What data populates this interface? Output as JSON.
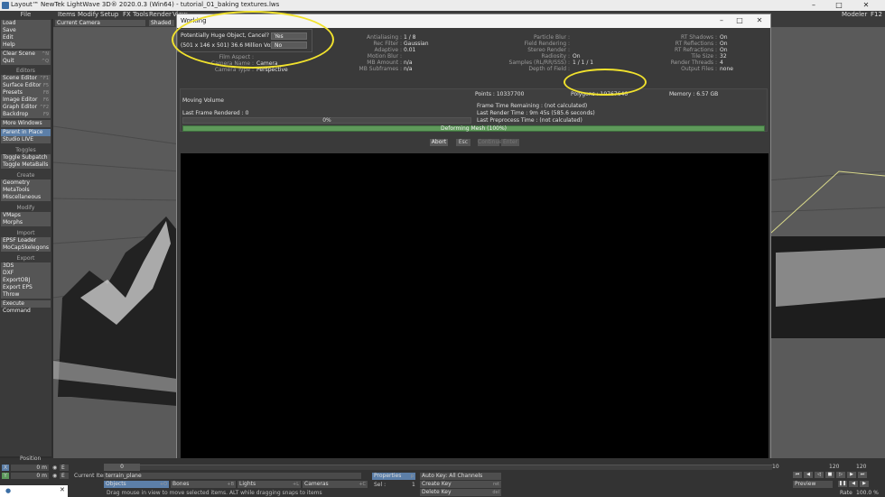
{
  "window": {
    "title": "Layout™ NewTek LightWave 3D® 2020.0.3 (Win64) - tutorial_01_baking textures.lws"
  },
  "menubar": {
    "file": "File",
    "items": [
      "Items",
      "Modify",
      "Setup",
      "FX Tools",
      "Render",
      "View"
    ],
    "modeler": "Modeler",
    "f12": "F12"
  },
  "left_panel": {
    "file_items": [
      {
        "label": "Load",
        "sc": ""
      },
      {
        "label": "Save",
        "sc": ""
      },
      {
        "label": "Edit",
        "sc": ""
      },
      {
        "label": "Help",
        "sc": ""
      },
      {
        "label": "Clear Scene",
        "sc": "^N"
      },
      {
        "label": "Quit",
        "sc": "^Q"
      }
    ],
    "editors_head": "Editors",
    "editors": [
      {
        "label": "Scene Editor",
        "sc": "^F1"
      },
      {
        "label": "Surface Editor",
        "sc": "F5"
      },
      {
        "label": "Presets",
        "sc": "F8"
      },
      {
        "label": "Image Editor",
        "sc": "F6"
      },
      {
        "label": "Graph Editor",
        "sc": "^F2"
      },
      {
        "label": "Backdrop",
        "sc": "F9"
      },
      {
        "label": "More Windows",
        "sc": ""
      }
    ],
    "misc": [
      {
        "label": "Parent in Place",
        "sc": ""
      },
      {
        "label": "Studio LIVE",
        "sc": ""
      }
    ],
    "toggles_head": "Toggles",
    "toggles": [
      {
        "label": "Toggle Subpatch",
        "sc": ""
      },
      {
        "label": "Toggle MetaBalls",
        "sc": ""
      }
    ],
    "create_head": "Create",
    "create": [
      {
        "label": "Geometry",
        "sc": ""
      },
      {
        "label": "MetaTools",
        "sc": ""
      },
      {
        "label": "Miscellaneous",
        "sc": ""
      }
    ],
    "modify_head": "Modify",
    "modify": [
      {
        "label": "VMaps",
        "sc": ""
      },
      {
        "label": "Morphs",
        "sc": ""
      }
    ],
    "import_head": "Import",
    "import": [
      {
        "label": "EPSF Loader",
        "sc": ""
      },
      {
        "label": "MoCapSkelegons",
        "sc": ""
      }
    ],
    "export_head": "Export",
    "export": [
      {
        "label": "3DS",
        "sc": ""
      },
      {
        "label": "DXF",
        "sc": ""
      },
      {
        "label": "ExportOBJ",
        "sc": ""
      },
      {
        "label": "Export EPS",
        "sc": ""
      },
      {
        "label": "Throw",
        "sc": ""
      },
      {
        "label": "Execute Command",
        "sc": ""
      }
    ]
  },
  "viewport": {
    "camera": "Current Camera",
    "shaded": "Shaded"
  },
  "dialog": {
    "title": "Working",
    "left_stats": [
      {
        "label": "Film Aspect :",
        "value": ""
      },
      {
        "label": "Camera Name :",
        "value": "Camera"
      },
      {
        "label": "Camera Type :",
        "value": "Perspective"
      }
    ],
    "mid_stats": [
      {
        "label": "Antialiasing :",
        "value": "1 / 8"
      },
      {
        "label": "Rec Filter :",
        "value": "Gaussian"
      },
      {
        "label": "Adaptive :",
        "value": "0.01"
      },
      {
        "label": "Motion Blur :",
        "value": ""
      },
      {
        "label": "MB Amount :",
        "value": "n/a"
      },
      {
        "label": "MB Subframes :",
        "value": "n/a"
      }
    ],
    "right_stats": [
      {
        "label": "Particle Blur :",
        "value": ""
      },
      {
        "label": "Field Rendering :",
        "value": ""
      },
      {
        "label": "Stereo Render :",
        "value": ""
      },
      {
        "label": "Radiosity :",
        "value": "On"
      },
      {
        "label": "Samples (RL/RR/SSS) :",
        "value": "1 / 1 / 1"
      },
      {
        "label": "Depth of Field :",
        "value": ""
      }
    ],
    "far_stats": [
      {
        "label": "RT Shadows :",
        "value": "On"
      },
      {
        "label": "RT Reflections :",
        "value": "On"
      },
      {
        "label": "RT Refractions :",
        "value": "On"
      },
      {
        "label": "Tile Size :",
        "value": "32"
      },
      {
        "label": "Render Threads :",
        "value": "4"
      },
      {
        "label": "Output Files :",
        "value": "none"
      }
    ],
    "points": "Points : 10337700",
    "polygons": "Polygons : 19767646",
    "memory": "Memory : 6.57 GB",
    "status": "Moving Volume",
    "frame_time_remaining": "Frame Time Remaining : (not calculated)",
    "last_render_time": "Last Render Time : 9m 45s (585.6 seconds)",
    "last_preprocess_time": "Last Preprocess Time : (not calculated)",
    "last_frame_rendered": "Last Frame Rendered : 0",
    "progress1_text": "0%",
    "progress2_text": "Deforming Mesh (100%)",
    "abort": "Abort",
    "esc": "Esc",
    "btn_continue": "Continue",
    "btn_enter": "Enter"
  },
  "warning": {
    "message": "Potentially Huge Object, Cancel?",
    "info": "(501 x 146 x 501) 36.6 Million Voxels",
    "yes": "Yes",
    "no": "No"
  },
  "bottom": {
    "position": "Position",
    "x_axis": "X",
    "y_axis": "Y",
    "x_val": "0 m",
    "y_val": "0 m",
    "e": "E",
    "frame": "0",
    "current_item_label": "Current Item",
    "current_item": "terrain_plane",
    "objects": "Objects",
    "bones": "Bones",
    "lights": "Lights",
    "cameras": "Cameras",
    "sc_o": "+O",
    "sc_b": "+B",
    "sc_l": "+L",
    "sc_c": "+C",
    "properties": "Properties",
    "sc_p": "p",
    "sel": "Sel :",
    "sel_val": "1",
    "auto_key": "Auto Key: All Channels",
    "create_key": "Create Key",
    "delete_key": "Delete Key",
    "sc_ret": "ret",
    "sc_del": "del",
    "status": "Drag mouse in view to move selected items. ALT while dragging snaps to items",
    "end_frame_1": "120",
    "end_frame_2": "120",
    "end_frame_3": "10",
    "preview": "Preview",
    "step": "Step",
    "step_val": "1",
    "rate": "Rate",
    "rate_val": "100.0 %"
  }
}
